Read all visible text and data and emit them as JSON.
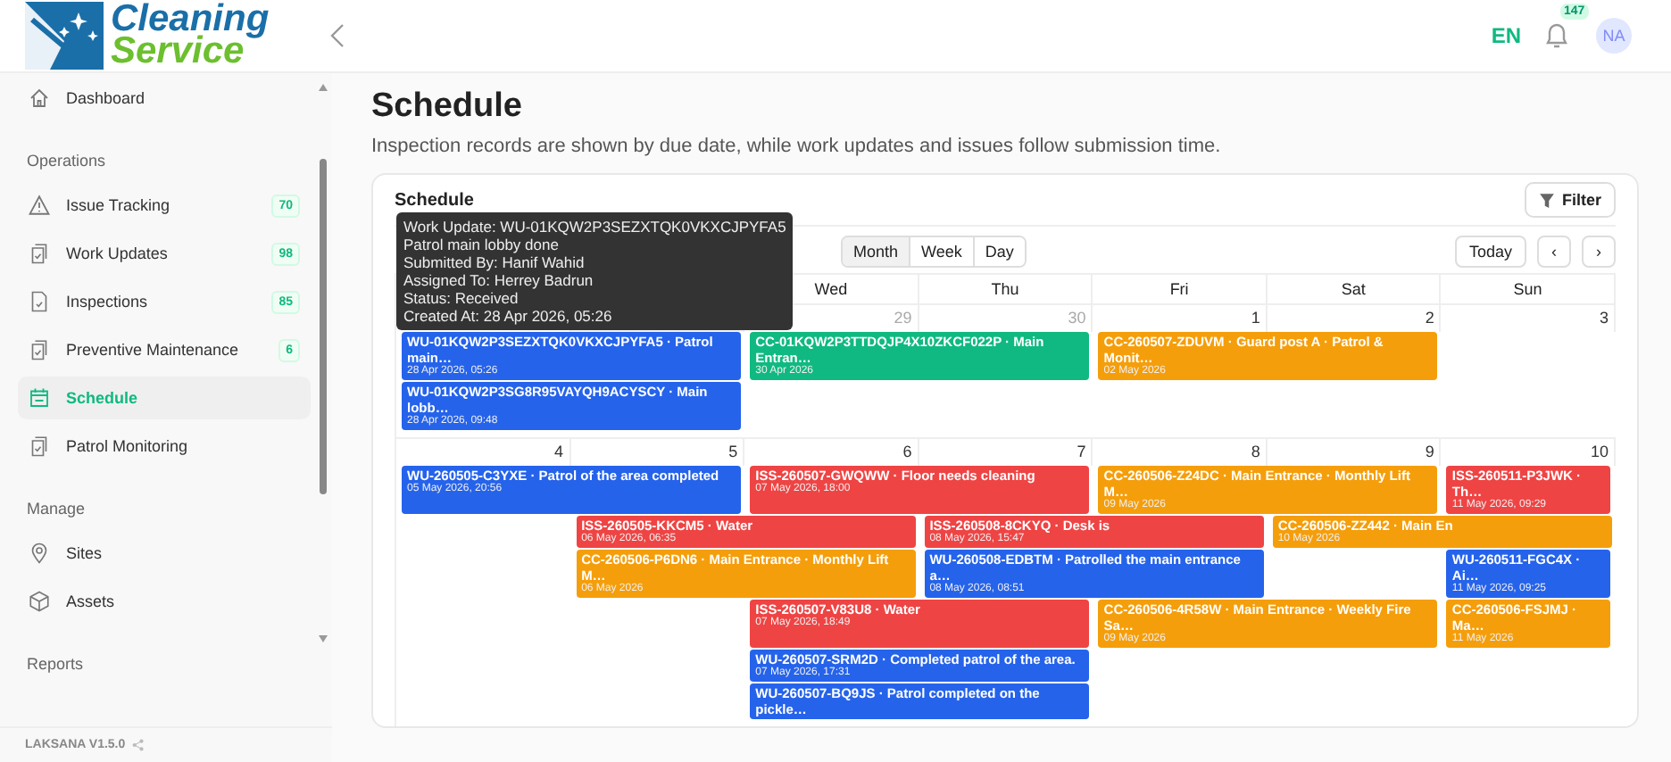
{
  "header": {
    "logo_top": "Cleaning",
    "logo_bottom": "Service",
    "language": {
      "label": "EN",
      "active": true
    },
    "notifications": "147",
    "avatar": "NA"
  },
  "sidebar": {
    "sections": [
      {
        "items": [
          {
            "label": "Dashboard",
            "selected": false
          }
        ]
      },
      {
        "title": "Operations",
        "items": [
          {
            "label": "Issue Tracking",
            "badge": "70",
            "selected": false
          },
          {
            "label": "Work Updates",
            "badge": "98",
            "selected": false
          },
          {
            "label": "Inspections",
            "badge": "85",
            "selected": false
          },
          {
            "label": "Preventive Maintenance",
            "badge": "6",
            "selected": false
          },
          {
            "label": "Schedule",
            "selected": true
          },
          {
            "label": "Patrol Monitoring",
            "selected": false
          }
        ]
      },
      {
        "title": "Manage",
        "items": [
          {
            "label": "Sites",
            "selected": false
          },
          {
            "label": "Assets",
            "selected": false
          }
        ]
      },
      {
        "title": "Reports"
      }
    ],
    "version": "LAKSANA V1.5.0"
  },
  "page": {
    "title": "Schedule",
    "description": "Inspection records are shown by due date, while work updates and issues follow submission time."
  },
  "calendar": {
    "title": "Schedule",
    "filter_button": "Filter",
    "views": [
      {
        "label": "Month",
        "selected": true
      },
      {
        "label": "Week",
        "selected": false
      },
      {
        "label": "Day",
        "selected": false
      }
    ],
    "today_button": "Today",
    "prev_button": "‹",
    "next_button": "›",
    "weekdays": [
      {
        "label": "Wed"
      },
      {
        "label": "Thu"
      },
      {
        "label": "Fri"
      },
      {
        "label": "Sat"
      },
      {
        "label": "Sun"
      }
    ],
    "tooltip": [
      "Work Update: WU-01KQW2P3SEZXTQK0VKXCJPYFA5",
      "Patrol main lobby done",
      "Submitted By: Hanif Wahid",
      "Assigned To: Herrey Badrun",
      "Status: Received",
      "Created At: 28 Apr 2026, 05:26"
    ],
    "weeks": [
      {
        "days": [
          {
            "events": [
              {
                "title": "WU-01KQW2P3SEZXTQK0VKXCJPYFA5 · Patrol main…",
                "time": "28 Apr 2026, 05:26",
                "color": "#2563eb",
                "multi_day": true
              },
              {
                "title": "WU-01KQW2P3SG8R95VAYQH9ACYSCY · Main lobb…",
                "time": "28 Apr 2026, 09:48",
                "color": "#2563eb",
                "multi_day": true
              }
            ]
          },
          {
            "kind": "covered"
          },
          {
            "number": "29",
            "muted": true,
            "events": [
              {
                "title": "CC-01KQW2P3TTDQJP4X10ZKCF022P · Main Entran…",
                "time": "30 Apr 2026",
                "color": "#10b981",
                "multi_day": true
              }
            ]
          },
          {
            "number": "30",
            "muted": true
          },
          {
            "number": "1",
            "muted": false,
            "events": [
              {
                "title": "CC-260507-ZDUVM · Guard post A · Patrol & Monit…",
                "time": "02 May 2026",
                "color": "#f59e0b",
                "multi_day": true
              }
            ]
          },
          {
            "number": "2",
            "muted": false
          },
          {
            "number": "3",
            "muted": false
          }
        ]
      },
      {
        "days": [
          {
            "number": "4",
            "muted": false,
            "events": [
              {
                "title": "WU-260505-C3YXE · Patrol of the area completed",
                "time": "05 May 2026, 20:56",
                "color": "#2563eb",
                "multi_day": true
              }
            ]
          },
          {
            "number": "5",
            "muted": false,
            "events": [
              {
                "title": "ISS-260505-KKCM5 · Water",
                "time": "06 May 2026, 06:35",
                "color": "#ef4444",
                "multi_day": true
              },
              {
                "title": "CC-260506-P6DN6 · Main Entrance · Monthly Lift M…",
                "time": "06 May 2026",
                "color": "#f59e0b",
                "multi_day": true
              }
            ]
          },
          {
            "number": "6",
            "muted": false,
            "events": [
              {
                "title": "ISS-260507-GWQWW · Floor needs cleaning",
                "time": "07 May 2026, 18:00",
                "color": "#ef4444",
                "multi_day": true
              },
              {
                "title": "ISS-260507-V83U8 · Water",
                "time": "07 May 2026, 18:49",
                "color": "#ef4444",
                "multi_day": true
              },
              {
                "title": "WU-260507-SRM2D · Completed patrol of the area.",
                "time": "07 May 2026, 17:31",
                "color": "#2563eb",
                "multi_day": true
              },
              {
                "title": "WU-260507-BQ9JS · Patrol completed on the pickle…",
                "color": "#2563eb",
                "multi_day": true
              }
            ]
          },
          {
            "number": "7",
            "muted": false,
            "events": [
              {
                "title": "ISS-260508-8CKYQ · Desk is",
                "time": "08 May 2026, 15:47",
                "color": "#ef4444",
                "multi_day": true
              },
              {
                "title": "WU-260508-EDBTM · Patrolled the main entrance a…",
                "time": "08 May 2026, 08:51",
                "color": "#2563eb",
                "multi_day": true
              }
            ]
          },
          {
            "number": "8",
            "muted": false,
            "events": [
              {
                "title": "CC-260506-Z24DC · Main Entrance · Monthly Lift M…",
                "time": "09 May 2026",
                "color": "#f59e0b",
                "multi_day": true
              },
              {
                "title": "CC-260506-4R58W · Main Entrance · Weekly Fire Sa…",
                "time": "09 May 2026",
                "color": "#f59e0b",
                "multi_day": true
              }
            ]
          },
          {
            "number": "9",
            "muted": false,
            "events": [
              {
                "title": "CC-260506-ZZ442 · Main En",
                "time": "10 May 2026",
                "color": "#f59e0b",
                "multi_day": true
              }
            ]
          },
          {
            "number": "10",
            "muted": false,
            "events": [
              {
                "title": "ISS-260511-P3JWK · Th…",
                "time": "11 May 2026, 09:29",
                "color": "#ef4444",
                "multi_day": false
              },
              {
                "title": "WU-260511-FGC4X · Ai…",
                "time": "11 May 2026, 09:25",
                "color": "#2563eb",
                "multi_day": false
              },
              {
                "title": "CC-260506-FSJMJ · Ma…",
                "time": "11 May 2026",
                "color": "#f59e0b",
                "multi_day": false
              }
            ]
          }
        ]
      }
    ]
  }
}
